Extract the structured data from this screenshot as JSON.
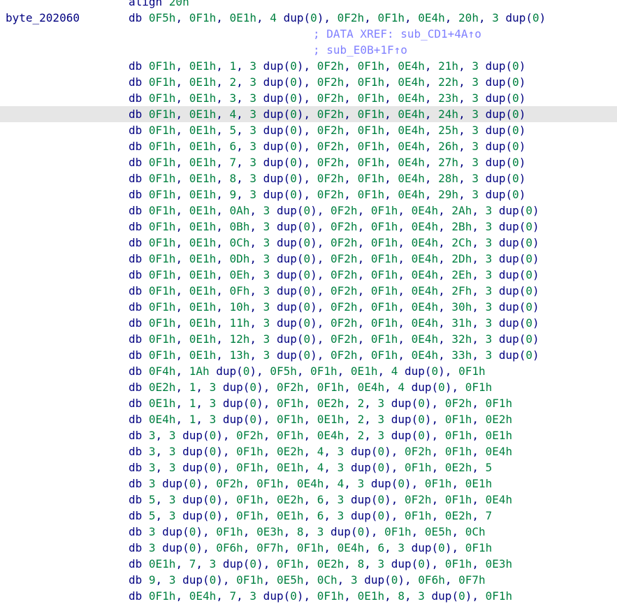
{
  "colors": {
    "instruction": "#000080",
    "number": "#008040",
    "comment": "#8080ff",
    "highlight": "#e6e6e6",
    "background": "#ffffff"
  },
  "highlight_line": 7,
  "lines": [
    {
      "label": "",
      "code": "align 20h",
      "comment": ""
    },
    {
      "label": "byte_202060",
      "code": "db 0F5h, 0F1h, 0E1h, 4 dup(0), 0F2h, 0F1h, 0E4h, 20h, 3 dup(0)",
      "comment": ""
    },
    {
      "label": "",
      "code": "",
      "comment": "; DATA XREF: sub_CD1+4A↑o"
    },
    {
      "label": "",
      "code": "",
      "comment": "; sub_E0B+1F↑o"
    },
    {
      "label": "",
      "code": "db 0F1h, 0E1h, 1, 3 dup(0), 0F2h, 0F1h, 0E4h, 21h, 3 dup(0)",
      "comment": ""
    },
    {
      "label": "",
      "code": "db 0F1h, 0E1h, 2, 3 dup(0), 0F2h, 0F1h, 0E4h, 22h, 3 dup(0)",
      "comment": ""
    },
    {
      "label": "",
      "code": "db 0F1h, 0E1h, 3, 3 dup(0), 0F2h, 0F1h, 0E4h, 23h, 3 dup(0)",
      "comment": ""
    },
    {
      "label": "",
      "code": "db 0F1h, 0E1h, 4, 3 dup(0), 0F2h, 0F1h, 0E4h, 24h, 3 dup(0)",
      "comment": ""
    },
    {
      "label": "",
      "code": "db 0F1h, 0E1h, 5, 3 dup(0), 0F2h, 0F1h, 0E4h, 25h, 3 dup(0)",
      "comment": ""
    },
    {
      "label": "",
      "code": "db 0F1h, 0E1h, 6, 3 dup(0), 0F2h, 0F1h, 0E4h, 26h, 3 dup(0)",
      "comment": ""
    },
    {
      "label": "",
      "code": "db 0F1h, 0E1h, 7, 3 dup(0), 0F2h, 0F1h, 0E4h, 27h, 3 dup(0)",
      "comment": ""
    },
    {
      "label": "",
      "code": "db 0F1h, 0E1h, 8, 3 dup(0), 0F2h, 0F1h, 0E4h, 28h, 3 dup(0)",
      "comment": ""
    },
    {
      "label": "",
      "code": "db 0F1h, 0E1h, 9, 3 dup(0), 0F2h, 0F1h, 0E4h, 29h, 3 dup(0)",
      "comment": ""
    },
    {
      "label": "",
      "code": "db 0F1h, 0E1h, 0Ah, 3 dup(0), 0F2h, 0F1h, 0E4h, 2Ah, 3 dup(0)",
      "comment": ""
    },
    {
      "label": "",
      "code": "db 0F1h, 0E1h, 0Bh, 3 dup(0), 0F2h, 0F1h, 0E4h, 2Bh, 3 dup(0)",
      "comment": ""
    },
    {
      "label": "",
      "code": "db 0F1h, 0E1h, 0Ch, 3 dup(0), 0F2h, 0F1h, 0E4h, 2Ch, 3 dup(0)",
      "comment": ""
    },
    {
      "label": "",
      "code": "db 0F1h, 0E1h, 0Dh, 3 dup(0), 0F2h, 0F1h, 0E4h, 2Dh, 3 dup(0)",
      "comment": ""
    },
    {
      "label": "",
      "code": "db 0F1h, 0E1h, 0Eh, 3 dup(0), 0F2h, 0F1h, 0E4h, 2Eh, 3 dup(0)",
      "comment": ""
    },
    {
      "label": "",
      "code": "db 0F1h, 0E1h, 0Fh, 3 dup(0), 0F2h, 0F1h, 0E4h, 2Fh, 3 dup(0)",
      "comment": ""
    },
    {
      "label": "",
      "code": "db 0F1h, 0E1h, 10h, 3 dup(0), 0F2h, 0F1h, 0E4h, 30h, 3 dup(0)",
      "comment": ""
    },
    {
      "label": "",
      "code": "db 0F1h, 0E1h, 11h, 3 dup(0), 0F2h, 0F1h, 0E4h, 31h, 3 dup(0)",
      "comment": ""
    },
    {
      "label": "",
      "code": "db 0F1h, 0E1h, 12h, 3 dup(0), 0F2h, 0F1h, 0E4h, 32h, 3 dup(0)",
      "comment": ""
    },
    {
      "label": "",
      "code": "db 0F1h, 0E1h, 13h, 3 dup(0), 0F2h, 0F1h, 0E4h, 33h, 3 dup(0)",
      "comment": ""
    },
    {
      "label": "",
      "code": "db 0F4h, 1Ah dup(0), 0F5h, 0F1h, 0E1h, 4 dup(0), 0F1h",
      "comment": ""
    },
    {
      "label": "",
      "code": "db 0E2h, 1, 3 dup(0), 0F2h, 0F1h, 0E4h, 4 dup(0), 0F1h",
      "comment": ""
    },
    {
      "label": "",
      "code": "db 0E1h, 1, 3 dup(0), 0F1h, 0E2h, 2, 3 dup(0), 0F2h, 0F1h",
      "comment": ""
    },
    {
      "label": "",
      "code": "db 0E4h, 1, 3 dup(0), 0F1h, 0E1h, 2, 3 dup(0), 0F1h, 0E2h",
      "comment": ""
    },
    {
      "label": "",
      "code": "db 3, 3 dup(0), 0F2h, 0F1h, 0E4h, 2, 3 dup(0), 0F1h, 0E1h",
      "comment": ""
    },
    {
      "label": "",
      "code": "db 3, 3 dup(0), 0F1h, 0E2h, 4, 3 dup(0), 0F2h, 0F1h, 0E4h",
      "comment": ""
    },
    {
      "label": "",
      "code": "db 3, 3 dup(0), 0F1h, 0E1h, 4, 3 dup(0), 0F1h, 0E2h, 5",
      "comment": ""
    },
    {
      "label": "",
      "code": "db 3 dup(0), 0F2h, 0F1h, 0E4h, 4, 3 dup(0), 0F1h, 0E1h",
      "comment": ""
    },
    {
      "label": "",
      "code": "db 5, 3 dup(0), 0F1h, 0E2h, 6, 3 dup(0), 0F2h, 0F1h, 0E4h",
      "comment": ""
    },
    {
      "label": "",
      "code": "db 5, 3 dup(0), 0F1h, 0E1h, 6, 3 dup(0), 0F1h, 0E2h, 7",
      "comment": ""
    },
    {
      "label": "",
      "code": "db 3 dup(0), 0F1h, 0E3h, 8, 3 dup(0), 0F1h, 0E5h, 0Ch",
      "comment": ""
    },
    {
      "label": "",
      "code": "db 3 dup(0), 0F6h, 0F7h, 0F1h, 0E4h, 6, 3 dup(0), 0F1h",
      "comment": ""
    },
    {
      "label": "",
      "code": "db 0E1h, 7, 3 dup(0), 0F1h, 0E2h, 8, 3 dup(0), 0F1h, 0E3h",
      "comment": ""
    },
    {
      "label": "",
      "code": "db 9, 3 dup(0), 0F1h, 0E5h, 0Ch, 3 dup(0), 0F6h, 0F7h",
      "comment": ""
    },
    {
      "label": "",
      "code": "db 0F1h, 0E4h, 7, 3 dup(0), 0F1h, 0E1h, 8, 3 dup(0), 0F1h",
      "comment": ""
    }
  ]
}
